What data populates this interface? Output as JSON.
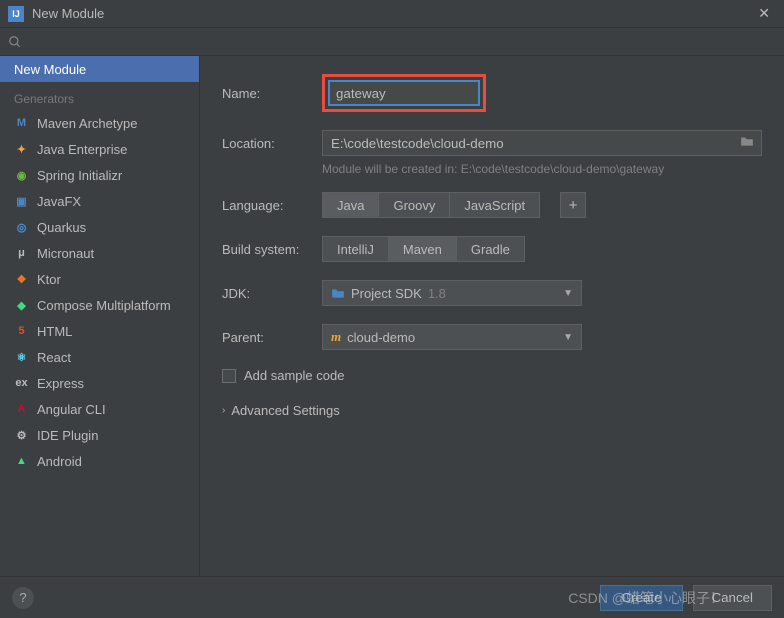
{
  "titlebar": {
    "title": "New Module"
  },
  "sidebar": {
    "top": "New Module",
    "section": "Generators",
    "items": [
      {
        "label": "Maven Archetype",
        "icon": "M",
        "color": "#4a86c7"
      },
      {
        "label": "Java Enterprise",
        "icon": "✦",
        "color": "#f0a732"
      },
      {
        "label": "Spring Initializr",
        "icon": "◉",
        "color": "#6db33f"
      },
      {
        "label": "JavaFX",
        "icon": "▣",
        "color": "#4a86c7"
      },
      {
        "label": "Quarkus",
        "icon": "◎",
        "color": "#4695eb"
      },
      {
        "label": "Micronaut",
        "icon": "μ",
        "color": "#bbbbbb"
      },
      {
        "label": "Ktor",
        "icon": "❖",
        "color": "#f07427"
      },
      {
        "label": "Compose Multiplatform",
        "icon": "◆",
        "color": "#3ddc84"
      },
      {
        "label": "HTML",
        "icon": "5",
        "color": "#e44d26"
      },
      {
        "label": "React",
        "icon": "⚛",
        "color": "#61dafb"
      },
      {
        "label": "Express",
        "icon": "ex",
        "color": "#bbbbbb"
      },
      {
        "label": "Angular CLI",
        "icon": "A",
        "color": "#dd0031"
      },
      {
        "label": "IDE Plugin",
        "icon": "⚙",
        "color": "#bbbbbb"
      },
      {
        "label": "Android",
        "icon": "▲",
        "color": "#3ddc84"
      }
    ]
  },
  "form": {
    "name_label": "Name:",
    "name_value": "gateway",
    "location_label": "Location:",
    "location_value": "E:\\code\\testcode\\cloud-demo",
    "hint": "Module will be created in: E:\\code\\testcode\\cloud-demo\\gateway",
    "language_label": "Language:",
    "languages": [
      "Java",
      "Groovy",
      "JavaScript"
    ],
    "language_selected": "Java",
    "build_label": "Build system:",
    "builds": [
      "IntelliJ",
      "Maven",
      "Gradle"
    ],
    "build_selected": "Maven",
    "jdk_label": "JDK:",
    "jdk_value": "Project SDK",
    "jdk_version": "1.8",
    "parent_label": "Parent:",
    "parent_value": "cloud-demo",
    "checkbox_label": "Add sample code",
    "advanced": "Advanced Settings"
  },
  "footer": {
    "create": "Create",
    "cancel": "Cancel"
  },
  "watermark": "CSDN @蜡笔小心眼子！"
}
